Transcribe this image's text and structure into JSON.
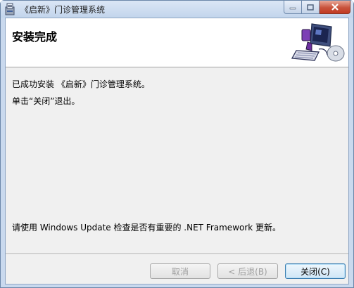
{
  "window": {
    "title": "《启新》门诊管理系统",
    "icon": "installer-icon"
  },
  "banner": {
    "heading": "安装完成",
    "graphic": "computer-with-disc-icon"
  },
  "messages": {
    "installed": "已成功安装 《启新》门诊管理系统。",
    "instruction": "单击“关闭”退出。",
    "update_hint": "请使用 Windows Update 检查是否有重要的 .NET Framework 更新。"
  },
  "buttons": {
    "cancel": "取消",
    "back": "< 后退(B)",
    "close": "关闭(C)"
  },
  "colors": {
    "close_caption": "#c8533c",
    "primary_button_border": "#3c7fb1"
  }
}
